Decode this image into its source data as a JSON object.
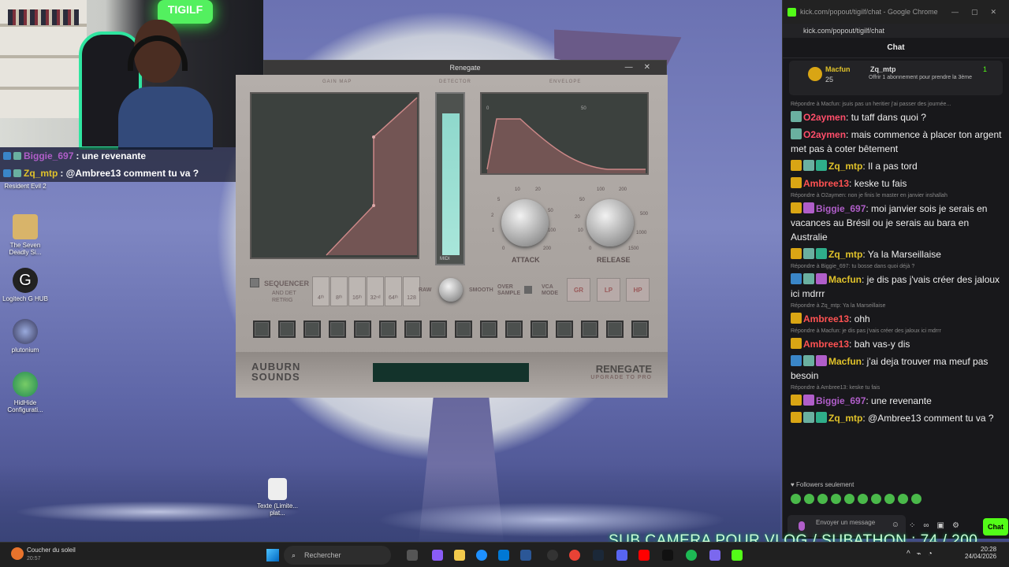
{
  "overlay_chat": [
    {
      "user": "Biggie_697",
      "message": ": une revenante",
      "color": "#b05ec9"
    },
    {
      "user": "Zq_mtp",
      "message": ": @Ambree13 comment tu va ?",
      "color": "#e0c22a"
    }
  ],
  "desktop_icons": [
    {
      "label": "Resident Evil 2",
      "icon": "game-icon"
    },
    {
      "label": "The Seven Deadly Si...",
      "icon": "game-icon"
    },
    {
      "label": "Logitech G HUB",
      "icon": "logitech-icon"
    },
    {
      "label": "plutonium",
      "icon": "atom-icon"
    },
    {
      "label": "HidHide Configurati...",
      "icon": "hidhide-icon"
    },
    {
      "label": "Texte (Limite... plat...",
      "icon": "chrome-file-icon"
    }
  ],
  "plugin": {
    "title": "Renegate",
    "sections": {
      "gain_map": "GAIN MAP",
      "detector": "DETECTOR",
      "envelope": "ENVELOPE"
    },
    "detector_label": "MIDI",
    "attack": {
      "label": "ATTACK",
      "ticks": [
        "10",
        "20",
        "50",
        "100",
        "200",
        "0",
        "1",
        "2",
        "5"
      ]
    },
    "release": {
      "label": "RELEASE",
      "ticks": [
        "100",
        "200",
        "500",
        "1000",
        "1500",
        "0",
        "10",
        "20",
        "50"
      ]
    },
    "sequencer": {
      "label": "SEQUENCER",
      "and_det": "AND DET",
      "retrig": "RETRIG"
    },
    "notes": [
      "4ᵗʰ",
      "8ᵗʰ",
      "16ᵗʰ",
      "32ⁿᵈ",
      "64ᵗʰ",
      "128"
    ],
    "raw": "RAW",
    "smooth": "SMOOTH",
    "oversample": "OVER SAMPLE",
    "vca_mode": "VCA MODE",
    "modes": [
      "GR",
      "LP",
      "HP"
    ],
    "brand": "AUBURN SOUNDS",
    "product": "RENEGATE",
    "upgrade": "UPGRADE TO PRO",
    "envelope_marks": [
      "0",
      "50"
    ]
  },
  "chat_window": {
    "browser_title": "kick.com/popout/tigilf/chat - Google Chrome",
    "url": "kick.com/popout/tigilf/chat",
    "header": "Chat",
    "pinned": {
      "user": "Macfun",
      "count": "25",
      "gifter": "Zq_mtp",
      "text": "Offrir 1 abonnement pour prendre la 3ème",
      "rank": "1"
    },
    "messages": [
      {
        "reply": "Répondre à Macfun: jsuis pas un heritier j'ai passer des journée..."
      },
      {
        "user": "O2aymen",
        "color": "#ff4e6a",
        "text": ": tu taff dans quoi ?",
        "badges": [
          "box"
        ]
      },
      {
        "user": "O2aymen",
        "color": "#ff4e6a",
        "text": ": mais commence à placer ton argent met pas à coter bêtement",
        "badges": [
          "box"
        ]
      },
      {
        "user": "Zq_mtp",
        "color": "#e0c22a",
        "text": ": Il a pas tord",
        "badges": [
          "crown",
          "box",
          "gift"
        ]
      },
      {
        "user": "Ambree13",
        "color": "#ff5252",
        "text": ": keske tu fais",
        "badges": [
          "crown"
        ]
      },
      {
        "reply": "Répondre à O2aymen: non je finis le master en janvier inshallah"
      },
      {
        "user": "Biggie_697",
        "color": "#b05ec9",
        "text": ": moi janvier sois je serais en vacances au Brésil ou je serais au bara en Australie",
        "badges": [
          "crown",
          "vip"
        ]
      },
      {
        "user": "Zq_mtp",
        "color": "#e0c22a",
        "text": ": Ya la Marseillaise",
        "badges": [
          "crown",
          "box",
          "gift"
        ]
      },
      {
        "reply": "Répondre à Biggie_697: tu bosse dans quoi déjà ?"
      },
      {
        "user": "Macfun",
        "color": "#e0c22a",
        "text": ": je dis pas j'vais créer des jaloux ici mdrrr",
        "badges": [
          "blue",
          "box",
          "vip"
        ]
      },
      {
        "reply": "Répondre à Zq_mtp: Ya la Marseillaise"
      },
      {
        "user": "Ambree13",
        "color": "#ff5252",
        "text": ": ohh",
        "badges": [
          "crown"
        ]
      },
      {
        "reply": "Répondre à Macfun: je dis pas j'vais créer des jaloux ici mdrrr"
      },
      {
        "user": "Ambree13",
        "color": "#ff5252",
        "text": ": bah vas-y dis",
        "badges": [
          "crown"
        ]
      },
      {
        "user": "Macfun",
        "color": "#e0c22a",
        "text": ": j'ai deja trouver ma meuf pas besoin",
        "badges": [
          "blue",
          "box",
          "vip"
        ]
      },
      {
        "reply": "Répondre à Ambree13: keske tu fais"
      },
      {
        "user": "Biggie_697",
        "color": "#b05ec9",
        "text": ": une revenante",
        "badges": [
          "crown",
          "vip"
        ]
      },
      {
        "user": "Zq_mtp",
        "color": "#e0c22a",
        "text": ": @Ambree13 comment tu va ?",
        "badges": [
          "crown",
          "box",
          "gift"
        ]
      }
    ],
    "followers_only": "Followers seulement",
    "input_placeholder": "Envoyer un message",
    "send": "Chat"
  },
  "taskbar": {
    "weather": "Coucher du soleil",
    "weather_temp": "20:57",
    "search": "Rechercher",
    "time": "20:28",
    "date": "24/04/2026"
  },
  "stream_overlay": "SUB CAMERA POUR VLOG / SUBATHON  :  74 / 200",
  "colors": {
    "kick_green": "#53fc18",
    "chat_bg": "#18181b",
    "taskbar": "#202020"
  }
}
